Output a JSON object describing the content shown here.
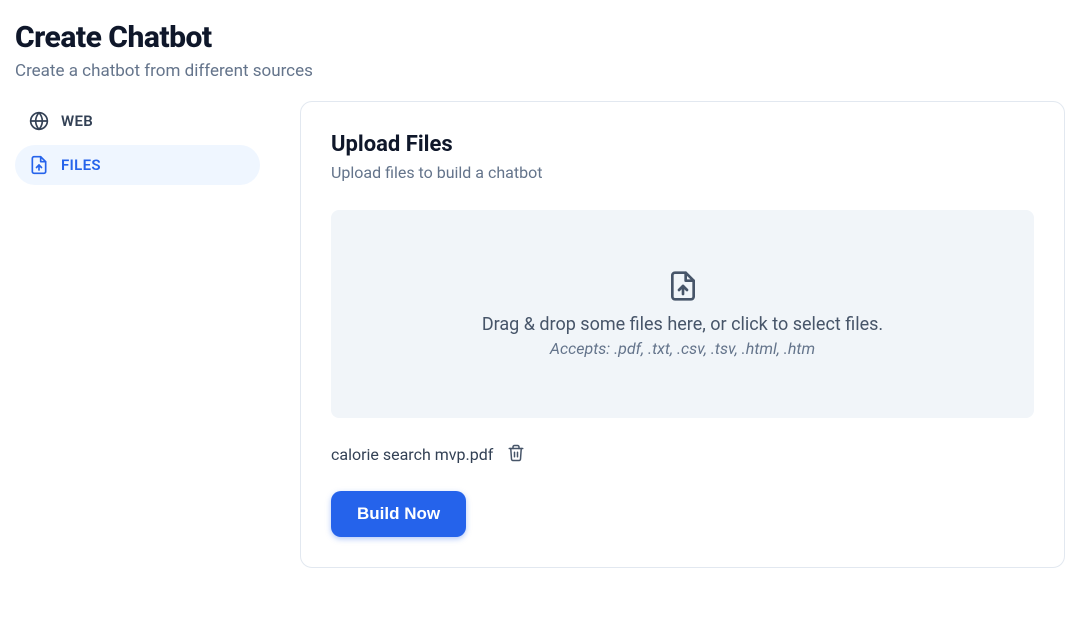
{
  "header": {
    "title": "Create Chatbot",
    "subtitle": "Create a chatbot from different sources"
  },
  "sidebar": {
    "items": [
      {
        "label": "WEB",
        "icon": "globe",
        "active": false
      },
      {
        "label": "FILES",
        "icon": "file-upload",
        "active": true
      }
    ]
  },
  "panel": {
    "title": "Upload Files",
    "subtitle": "Upload files to build a chatbot",
    "dropzone": {
      "text": "Drag & drop some files here, or click to select files.",
      "accepts": "Accepts: .pdf, .txt, .csv, .tsv, .html, .htm"
    },
    "uploaded_files": [
      {
        "name": "calorie search mvp.pdf"
      }
    ],
    "build_button": "Build Now"
  }
}
